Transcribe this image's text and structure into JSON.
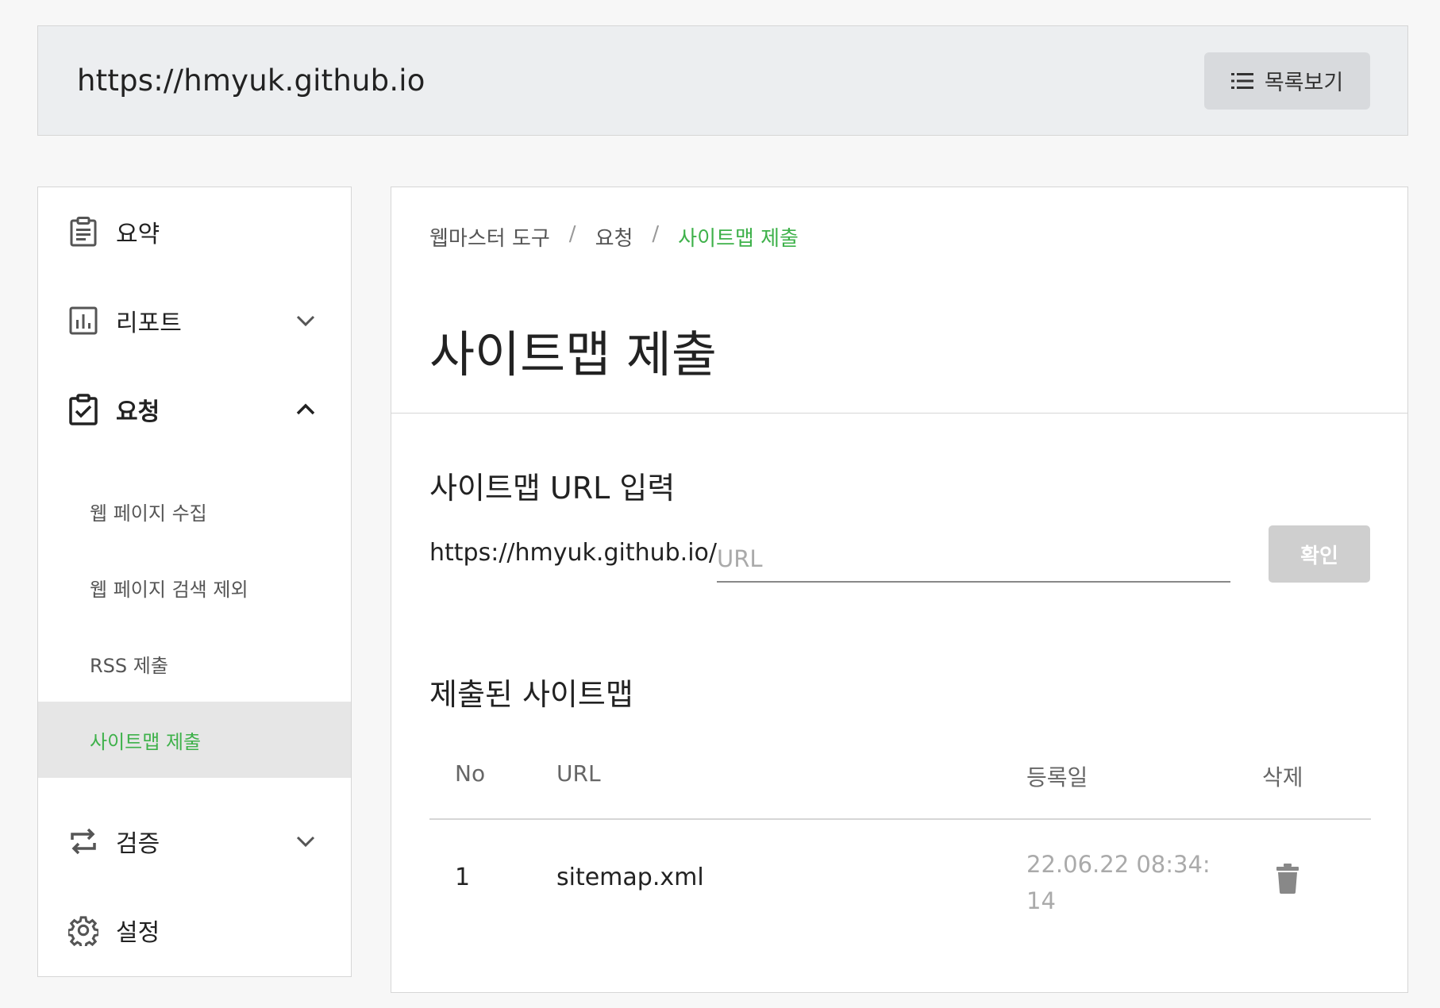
{
  "topbar": {
    "site_url": "https://hmyuk.github.io",
    "list_button": "목록보기"
  },
  "sidebar": {
    "items": [
      {
        "label": "요약",
        "icon": "clipboard-icon"
      },
      {
        "label": "리포트",
        "icon": "bar-chart-icon",
        "chevron": "chevron-down-icon"
      },
      {
        "label": "요청",
        "icon": "clipboard-check-icon",
        "chevron": "chevron-up-icon"
      },
      {
        "label": "검증",
        "icon": "repeat-icon",
        "chevron": "chevron-down-icon"
      },
      {
        "label": "설정",
        "icon": "gear-icon"
      }
    ],
    "sub_items": [
      {
        "label": "웹 페이지 수집"
      },
      {
        "label": "웹 페이지 검색 제외"
      },
      {
        "label": "RSS 제출"
      },
      {
        "label": "사이트맵 제출",
        "active": true
      }
    ]
  },
  "main": {
    "breadcrumb": [
      "웹마스터 도구",
      "요청",
      "사이트맵 제출"
    ],
    "breadcrumb_sep": "/",
    "title": "사이트맵 제출",
    "input_section_title": "사이트맵 URL 입력",
    "url_prefix": "https://hmyuk.github.io/",
    "url_placeholder": "URL",
    "confirm_button": "확인",
    "list_section_title": "제출된 사이트맵",
    "table": {
      "headers": [
        "No",
        "URL",
        "등록일",
        "삭제"
      ],
      "rows": [
        {
          "no": "1",
          "url": "sitemap.xml",
          "date": "22.06.22 08:34:14"
        }
      ]
    }
  },
  "colors": {
    "accent": "#3eb14a",
    "disabled_button": "#cfcfcf"
  }
}
